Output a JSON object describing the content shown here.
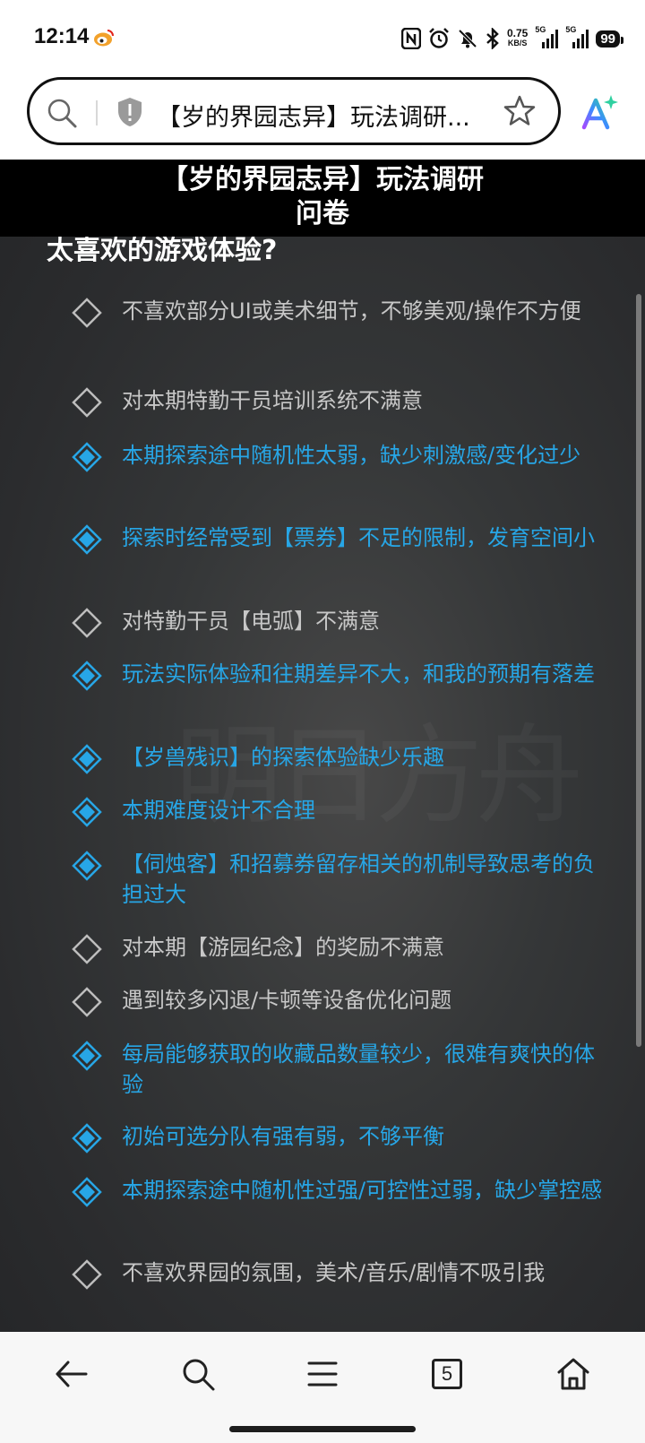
{
  "status_bar": {
    "time": "12:14",
    "net_speed_value": "0.75",
    "net_speed_unit": "KB/S",
    "signal1_label": "5G",
    "signal2_label": "5G",
    "battery": "99"
  },
  "browser": {
    "url_title": "【岁的界园志异】玩法调研..."
  },
  "page": {
    "header_title": "【岁的界园志异】玩法调研问卷",
    "question_text": "太喜欢的游戏体验?",
    "accent_color": "#27a6e6",
    "watermark": "明日方舟",
    "options": [
      {
        "label": "不喜欢部分UI或美术细节，不够美观/操作不方便",
        "selected": false
      },
      {
        "label": "对本期特勤干员培训系统不满意",
        "selected": false
      },
      {
        "label": "本期探索途中随机性太弱，缺少刺激感/变化过少",
        "selected": true
      },
      {
        "label": "探索时经常受到【票券】不足的限制，发育空间小",
        "selected": true
      },
      {
        "label": "对特勤干员【电弧】不满意",
        "selected": false
      },
      {
        "label": "玩法实际体验和往期差异不大，和我的预期有落差",
        "selected": true
      },
      {
        "label": "【岁兽残识】的探索体验缺少乐趣",
        "selected": true
      },
      {
        "label": "本期难度设计不合理",
        "selected": true
      },
      {
        "label": "【伺烛客】和招募券留存相关的机制导致思考的负担过大",
        "selected": true
      },
      {
        "label": "对本期【游园纪念】的奖励不满意",
        "selected": false
      },
      {
        "label": "遇到较多闪退/卡顿等设备优化问题",
        "selected": false
      },
      {
        "label": "每局能够获取的收藏品数量较少，很难有爽快的体验",
        "selected": true
      },
      {
        "label": "初始可选分队有强有弱，不够平衡",
        "selected": true
      },
      {
        "label": "本期探索途中随机性过强/可控性过弱，缺少掌控感",
        "selected": true
      },
      {
        "label": "不喜欢界园的氛围，美术/音乐/剧情不吸引我",
        "selected": false
      }
    ]
  },
  "bottom_nav": {
    "tabs_count": "5"
  }
}
